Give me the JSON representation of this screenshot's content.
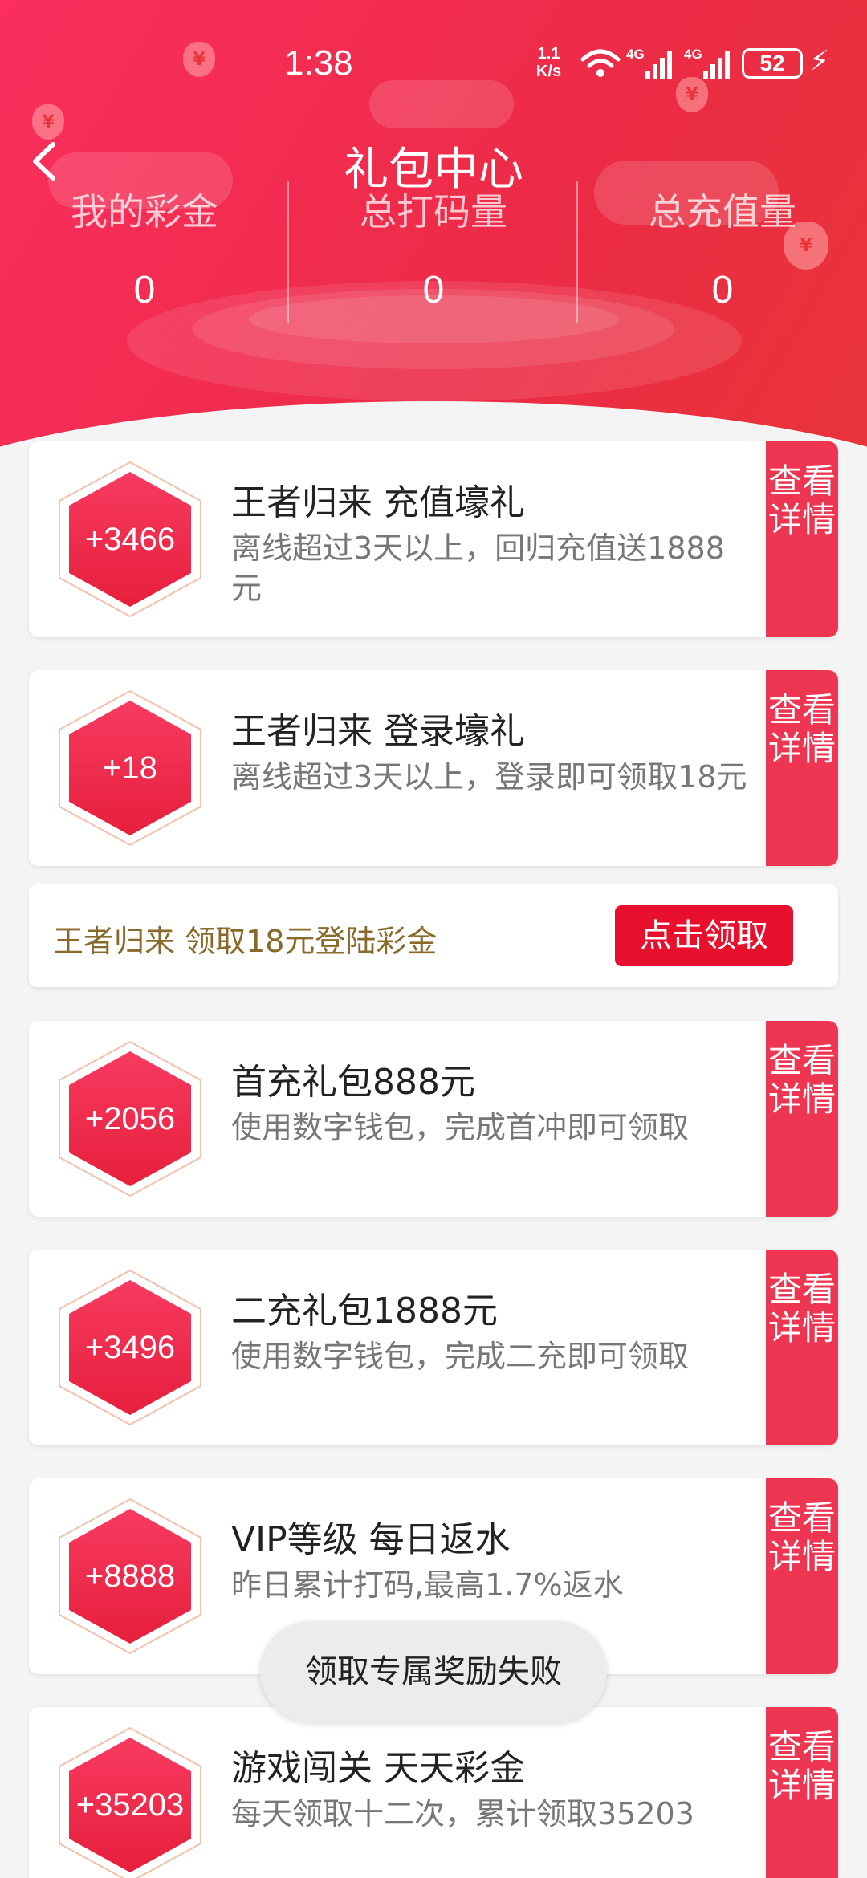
{
  "status_bar": {
    "time": "1:38",
    "net_speed_value": "1.1",
    "net_speed_unit": "K/s",
    "signal1": "4G",
    "signal2": "4G",
    "battery": "52"
  },
  "header": {
    "title": "礼包中心",
    "stats": [
      {
        "label": "我的彩金",
        "value": "0"
      },
      {
        "label": "总打码量",
        "value": "0"
      },
      {
        "label": "总充值量",
        "value": "0"
      }
    ],
    "coin_symbol": "¥"
  },
  "detail_label": "查看详情",
  "cards": [
    {
      "amount": "+3466",
      "title": "王者归来 充值壕礼",
      "desc": "离线超过3天以上，回归充值送1888元"
    },
    {
      "amount": "+18",
      "title": "王者归来 登录壕礼",
      "desc": "离线超过3天以上，登录即可领取18元"
    },
    {
      "amount": "+2056",
      "title": "首充礼包888元",
      "desc": "使用数字钱包，完成首冲即可领取"
    },
    {
      "amount": "+3496",
      "title": "二充礼包1888元",
      "desc": "使用数字钱包，完成二充即可领取"
    },
    {
      "amount": "+8888",
      "title": "VIP等级 每日返水",
      "desc": "昨日累计打码,最高1.7%返水"
    },
    {
      "amount": "+35203",
      "title": "游戏闯关 天天彩金",
      "desc": "每天领取十二次，累计领取35203"
    }
  ],
  "claim_row": {
    "text": "王者归来 领取18元登陆彩金",
    "button": "点击领取"
  },
  "toast": "领取专属奖励失败",
  "colors": {
    "header_start": "#fb2e5e",
    "header_end": "#e8343a",
    "accent": "#ee3552",
    "claim_button": "#e8102d",
    "claim_text": "#8a6a2a"
  }
}
